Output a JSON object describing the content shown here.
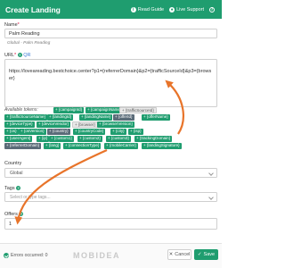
{
  "header": {
    "title": "Create Landing",
    "read_guide": "Read Guide",
    "live_support": "Live Support"
  },
  "form": {
    "name_label": "Name",
    "name_required": "*",
    "name_value": "Palm Reading",
    "name_hint": "Global - Palm Reading",
    "url_label": "URL",
    "url_required": "*",
    "url_qr": "QR",
    "url_value": "https://loveareading.bestchoice.center?p1={referrerDomain}&p2={trafficSourceId}&p3={browser}",
    "tokens_label": "Available tokens:",
    "tokens_row1": [
      "{campaignId}",
      "{campaignName}",
      "{trafficSourceId}"
    ],
    "tokens_row2": [
      "{trafficSourceName}",
      "{landingId}",
      "{landingName}",
      "{offerId}",
      "{offerName}"
    ],
    "tokens_row3": [
      "{deviceType}",
      "{deviceVendor}",
      "{browser}",
      "{browserVersion}"
    ],
    "tokens_row4": [
      "{os}",
      "{osVersion}",
      "{country}",
      "{countryCode}",
      "{city}",
      "{isp}"
    ],
    "tokens_row5": [
      "{userAgent}",
      "{ip}",
      "{custom1}",
      "{custom2}",
      "{custom3}",
      "{trackingDomain}"
    ],
    "tokens_row6": [
      "{referrerDomain}",
      "{lang}",
      "{connectionType}",
      "{mobileCarrier}",
      "{landingSignature}"
    ],
    "country_label": "Country",
    "country_value": "Global",
    "tags_label": "Tags",
    "tags_placeholder": "Select or type tags...",
    "offers_label": "Offers",
    "offers_value": "1"
  },
  "footer": {
    "status": "Errors occurred: 0",
    "brand": "MOBIDEA",
    "cancel": "Cancel",
    "save": "Save"
  },
  "colors": {
    "accent": "#1f9d6f",
    "arrow": "#e8742a"
  }
}
